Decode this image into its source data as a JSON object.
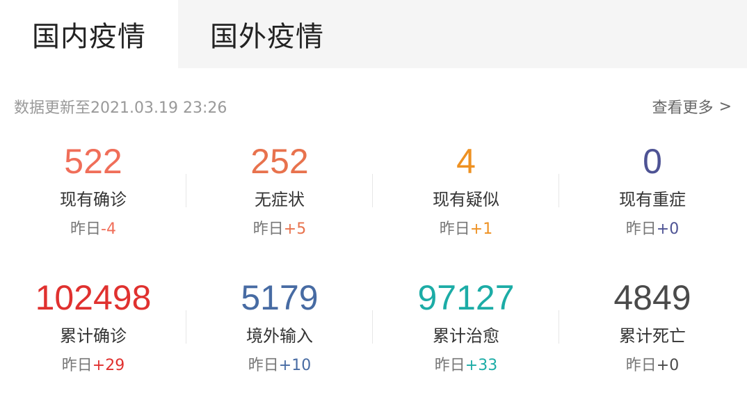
{
  "tabs": [
    {
      "label": "国内疫情",
      "active": true
    },
    {
      "label": "国外疫情",
      "active": false
    }
  ],
  "update_time": "数据更新至2021.03.19 23:26",
  "more_link": "查看更多",
  "more_chevron": ">",
  "yesterday_label": "昨日",
  "stats": [
    {
      "value": "522",
      "label": "现有确诊",
      "delta": "-4",
      "color": "#f06e59"
    },
    {
      "value": "252",
      "label": "无症状",
      "delta": "+5",
      "color": "#e8724d"
    },
    {
      "value": "4",
      "label": "现有疑似",
      "delta": "+1",
      "color": "#ee9122"
    },
    {
      "value": "0",
      "label": "现有重症",
      "delta": "+0",
      "color": "#4e5394"
    },
    {
      "value": "102498",
      "label": "累计确诊",
      "delta": "+29",
      "color": "#e0312f"
    },
    {
      "value": "5179",
      "label": "境外输入",
      "delta": "+10",
      "color": "#476ba3"
    },
    {
      "value": "97127",
      "label": "累计治愈",
      "delta": "+33",
      "color": "#1caca6"
    },
    {
      "value": "4849",
      "label": "累计死亡",
      "delta": "+0",
      "color": "#4a4a4a"
    }
  ]
}
